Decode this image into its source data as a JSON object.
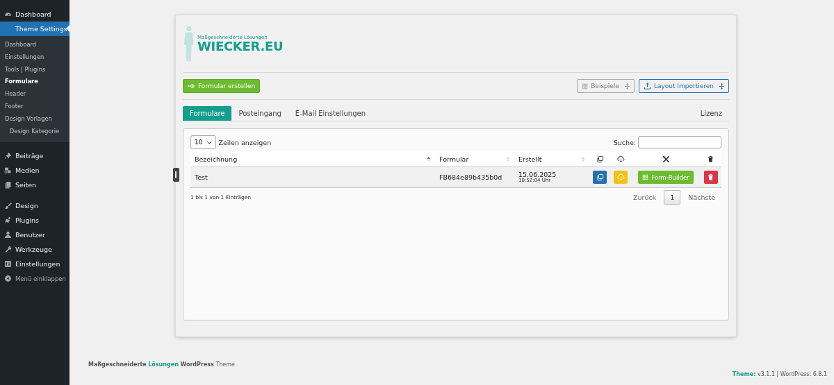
{
  "sidebar": {
    "groups": [
      [
        {
          "kind": "menu",
          "label": "Dashboard",
          "selected": false
        },
        {
          "kind": "menu",
          "label": "Theme Settings",
          "selected": true,
          "submenu": [
            {
              "label": "Dashboard",
              "selected": false
            },
            {
              "label": "Einstellungen",
              "selected": false
            },
            {
              "label": "Tools | Plugins",
              "selected": false
            },
            {
              "label": "Formulare",
              "selected": true
            },
            {
              "label": "Header",
              "selected": false
            },
            {
              "label": "Footer",
              "selected": false
            },
            {
              "label": "Design Vorlagen",
              "selected": false,
              "children": [
                {
                  "label": "Design Kategorie",
                  "selected": false
                }
              ]
            }
          ]
        }
      ],
      [
        {
          "kind": "menu",
          "label": "Beiträge",
          "selected": false
        },
        {
          "kind": "menu",
          "label": "Medien",
          "selected": false
        },
        {
          "kind": "menu",
          "label": "Seiten",
          "selected": false
        }
      ],
      [
        {
          "kind": "menu",
          "label": "Design",
          "selected": false
        },
        {
          "kind": "menu",
          "label": "Plugins",
          "selected": false
        },
        {
          "kind": "menu",
          "label": "Benutzer",
          "selected": false
        },
        {
          "kind": "menu",
          "label": "Werkzeuge",
          "selected": false
        },
        {
          "kind": "menu",
          "label": "Einstellungen",
          "selected": false
        },
        {
          "kind": "collapse",
          "label": "Menü einklappen",
          "selected": false
        }
      ]
    ]
  },
  "logo": {
    "tagline": "Maßgeschneiderte Lösungen",
    "name": "WIECKER.EU"
  },
  "toolbar": {
    "create_button": "Formular erstellen",
    "examples_button": "Beispiele",
    "import_button": "Layout Importieren"
  },
  "tabs": [
    {
      "label": "Formulare",
      "selected": true
    },
    {
      "label": "Posteingang",
      "selected": false
    },
    {
      "label": "E-Mail Einstellungen",
      "selected": false
    }
  ],
  "license_tab": {
    "label": "Lizenz",
    "selected": false
  },
  "table": {
    "length": "10",
    "length_label": "Zeilen anzeigen",
    "search_label": "Suche:",
    "columns": [
      {
        "label": "Bezeichnung",
        "sorted": true
      },
      {
        "label": "Formular",
        "sorted": false
      },
      {
        "label": "Erstellt",
        "sorted": false
      }
    ],
    "actions": [
      {
        "kind": "copy"
      },
      {
        "kind": "download"
      },
      {
        "kind": "builder",
        "label": "Form-Builder"
      },
      {
        "kind": "delete"
      }
    ],
    "rows": [
      {
        "name": "Test",
        "form_id": "FB684e89b435b0d",
        "date": "15.06.2025",
        "time": "10:52:04 Uhr"
      }
    ],
    "info": "1 bis 1 von 1 Einträgen",
    "pagination": {
      "previous": "Zurück",
      "pages": [
        {
          "label": "1",
          "selected": true
        }
      ],
      "next": "Nächste"
    }
  },
  "footer": {
    "credit": "**Maßgeschneiderte** *Lösungen* **WordPress** Theme",
    "version": "*Theme:* v3.1.1 | WordPress: 6.8.1"
  }
}
